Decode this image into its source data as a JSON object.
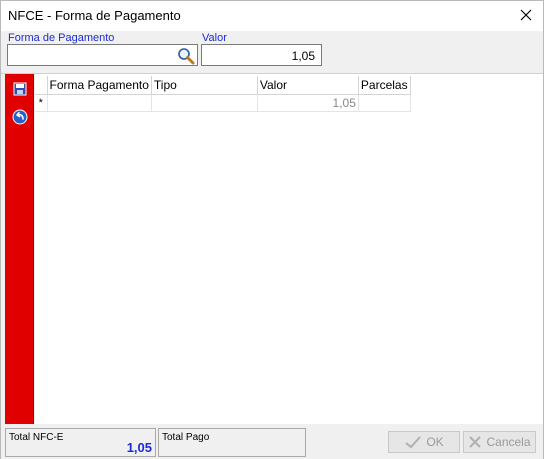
{
  "window": {
    "title": "NFCE - Forma de Pagamento"
  },
  "form": {
    "forma_label": "Forma de Pagamento",
    "forma_value": "",
    "valor_label": "Valor",
    "valor_value": "1,05"
  },
  "grid": {
    "columns": [
      "Forma Pagamento",
      "Tipo",
      "Valor",
      "Parcelas"
    ],
    "new_row_marker": "*",
    "new_row": {
      "forma": "",
      "tipo": "",
      "valor": "1,05",
      "parcelas": ""
    }
  },
  "footer": {
    "total_nfce_label": "Total NFC-E",
    "total_nfce_value": "1,05",
    "total_pago_label": "Total Pago",
    "total_pago_value": "",
    "ok_label": "OK",
    "cancel_label": "Cancela"
  },
  "colors": {
    "toolbar": "#e00000",
    "label_blue": "#1c2bd6"
  },
  "icons": [
    "close-icon",
    "search-icon",
    "save-icon",
    "back-icon",
    "check-icon",
    "cancel-icon"
  ]
}
